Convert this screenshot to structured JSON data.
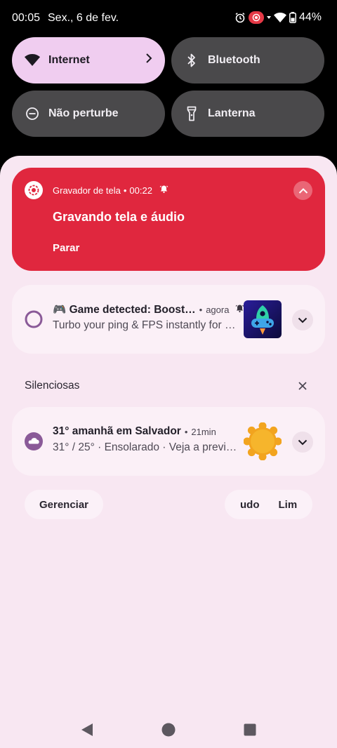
{
  "status_bar": {
    "time": "00:05",
    "date": "Sex., 6 de fev.",
    "battery": "44%",
    "icons": [
      "alarm-icon",
      "screen-record-icon",
      "wifi-icon",
      "battery-icon"
    ]
  },
  "quick_tiles": [
    {
      "label": "Internet",
      "icon": "wifi-icon",
      "state": "on"
    },
    {
      "label": "Bluetooth",
      "icon": "bluetooth-icon",
      "state": "off"
    },
    {
      "label": "Não perturbe",
      "icon": "do-not-disturb-icon",
      "state": "off"
    },
    {
      "label": "Lanterna",
      "icon": "flashlight-icon",
      "state": "off"
    }
  ],
  "recorder": {
    "app": "Gravador de tela",
    "timer": "00:22",
    "title": "Gravando tela e áudio",
    "action": "Parar",
    "color": "#e0273e"
  },
  "game_notification": {
    "title": "🎮 Game detected: Boost…",
    "time": "agora",
    "body": "Turbo your ping & FPS instantly for …"
  },
  "silent_section": {
    "label": "Silenciosas"
  },
  "weather_notification": {
    "title": "31° amanhã em Salvador",
    "time": "21min",
    "body": "31° / 25° · Ensolarado · Veja a previ…"
  },
  "footer": {
    "manage": "Gerenciar",
    "clear_all": "udo",
    "clear_partial": "Lim"
  },
  "navigation": [
    "back-icon",
    "home-icon",
    "recents-icon"
  ]
}
